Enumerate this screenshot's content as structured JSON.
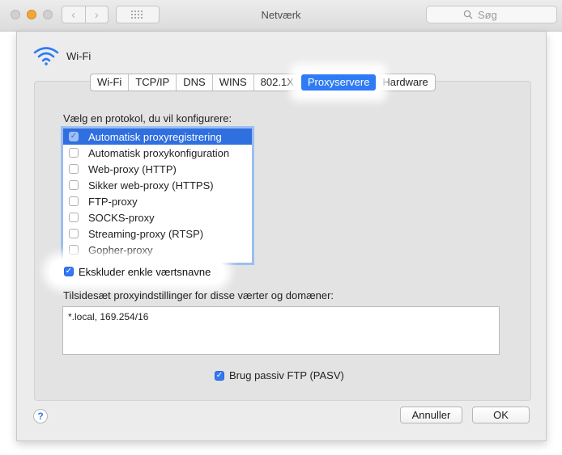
{
  "window": {
    "title": "Netværk"
  },
  "search": {
    "placeholder": "Søg"
  },
  "service": {
    "name": "Wi-Fi"
  },
  "tabs": [
    {
      "label": "Wi-Fi"
    },
    {
      "label": "TCP/IP"
    },
    {
      "label": "DNS"
    },
    {
      "label": "WINS"
    },
    {
      "label": "802.1X"
    },
    {
      "label": "Proxyservere",
      "active": true
    },
    {
      "label": "Hardware"
    }
  ],
  "proxy": {
    "protocol_label": "Vælg en protokol, du vil konfigurere:",
    "protocols": [
      {
        "label": "Automatisk proxyregistrering",
        "selected": true,
        "checked": true
      },
      {
        "label": "Automatisk proxykonfiguration",
        "checked": false
      },
      {
        "label": "Web-proxy (HTTP)",
        "checked": false
      },
      {
        "label": "Sikker web-proxy (HTTPS)",
        "checked": false
      },
      {
        "label": "FTP-proxy",
        "checked": false
      },
      {
        "label": "SOCKS-proxy",
        "checked": false
      },
      {
        "label": "Streaming-proxy (RTSP)",
        "checked": false
      },
      {
        "label": "Gopher-proxy",
        "checked": false
      }
    ],
    "exclude_simple_label": "Ekskluder enkle værtsnavne",
    "exclude_simple_checked": true,
    "bypass_label": "Tilsidesæt proxyindstillinger for disse værter og domæner:",
    "bypass_value": "*.local, 169.254/16",
    "pasv_label": "Brug passiv FTP (PASV)",
    "pasv_checked": true
  },
  "footer": {
    "help_glyph": "?",
    "cancel_label": "Annuller",
    "ok_label": "OK"
  },
  "colors": {
    "accent": "#2f7bf5",
    "selection": "#2f6fe0"
  }
}
